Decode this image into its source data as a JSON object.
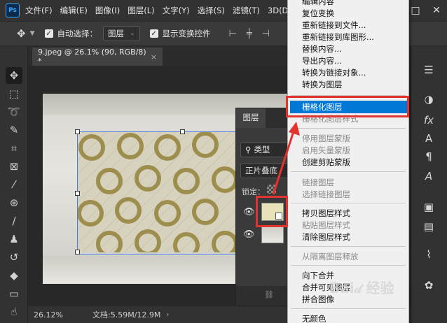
{
  "menubar": {
    "logo": "Ps",
    "items": [
      "文件(F)",
      "编辑(E)",
      "图像(I)",
      "图层(L)",
      "文字(Y)",
      "选择(S)",
      "滤镜(T)",
      "3D(D)"
    ],
    "window_buttons": [
      "—",
      "□",
      "✕"
    ]
  },
  "options": {
    "auto_select_label": "自动选择：",
    "auto_select_value": "图层",
    "show_transform_label": "显示变换控件"
  },
  "document": {
    "tab_title": "9.jpeg @ 26.1% (90, RGB/8) *",
    "tab_close": "×"
  },
  "status": {
    "zoom": "26.12%",
    "doc_size": "文档:5.59M/12.9M",
    "arrow": "›"
  },
  "layers": {
    "tab": "图层",
    "search_kind": "类型",
    "blend_mode": "正片叠底",
    "lock_label": "锁定："
  },
  "context_menu": {
    "items": [
      {
        "label": "编辑内容",
        "disabled": false
      },
      {
        "label": "复位变换",
        "disabled": false
      },
      {
        "label": "重新链接到文件...",
        "disabled": false
      },
      {
        "label": "重新链接到库图形...",
        "disabled": false
      },
      {
        "label": "替换内容...",
        "disabled": false
      },
      {
        "label": "导出内容...",
        "disabled": false
      },
      {
        "label": "转换为链接对象...",
        "disabled": false
      },
      {
        "label": "转换为图层",
        "disabled": false
      },
      {
        "label": "栅格化图层",
        "disabled": false,
        "highlighted": true
      },
      {
        "label": "栅格化图层样式",
        "disabled": true
      },
      {
        "label": "停用图层蒙版",
        "disabled": true
      },
      {
        "label": "启用矢量蒙版",
        "disabled": true
      },
      {
        "label": "创建剪贴蒙版",
        "disabled": false
      },
      {
        "label": "链接图层",
        "disabled": true
      },
      {
        "label": "选择链接图层",
        "disabled": true
      },
      {
        "label": "拷贝图层样式",
        "disabled": false
      },
      {
        "label": "粘贴图层样式",
        "disabled": true
      },
      {
        "label": "清除图层样式",
        "disabled": false
      },
      {
        "label": "从隔离图层释放",
        "disabled": true
      },
      {
        "label": "向下合并",
        "disabled": false
      },
      {
        "label": "合并可见图层",
        "disabled": false
      },
      {
        "label": "拼合图像",
        "disabled": false
      },
      {
        "label": "无颜色",
        "disabled": false
      }
    ]
  },
  "watermark": "Bai𝒹 经验",
  "colors": {
    "highlight": "#0078d7",
    "annotation_red": "#e4322e",
    "transform_border": "#4d7ae0"
  }
}
